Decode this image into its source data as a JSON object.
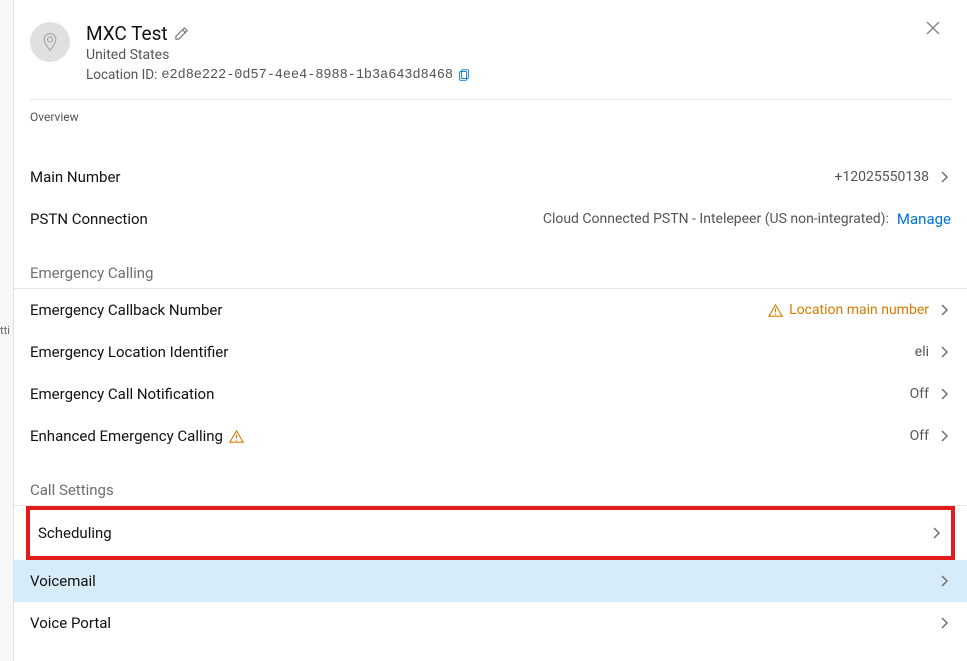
{
  "left_sliver_text": "tti",
  "header": {
    "title": "MXC Test",
    "country": "United States",
    "location_id_label": "Location ID:",
    "location_id": "e2d8e222-0d57-4ee4-8988-1b3a643d8468"
  },
  "tabs": {
    "overview": "Overview"
  },
  "overview_rows": {
    "main_number": {
      "label": "Main Number",
      "value": "+12025550138"
    },
    "pstn": {
      "label": "PSTN Connection",
      "value": "Cloud Connected PSTN - Intelepeer (US non-integrated):",
      "link": "Manage"
    }
  },
  "sections": {
    "emergency": {
      "header": "Emergency Calling",
      "callback": {
        "label": "Emergency Callback Number",
        "value": "Location main number"
      },
      "eli": {
        "label": "Emergency Location Identifier",
        "value": "eli"
      },
      "notification": {
        "label": "Emergency Call Notification",
        "value": "Off"
      },
      "enhanced": {
        "label": "Enhanced Emergency Calling",
        "value": "Off"
      }
    },
    "call_settings": {
      "header": "Call Settings",
      "scheduling": {
        "label": "Scheduling"
      },
      "voicemail": {
        "label": "Voicemail"
      },
      "voice_portal": {
        "label": "Voice Portal"
      }
    }
  }
}
